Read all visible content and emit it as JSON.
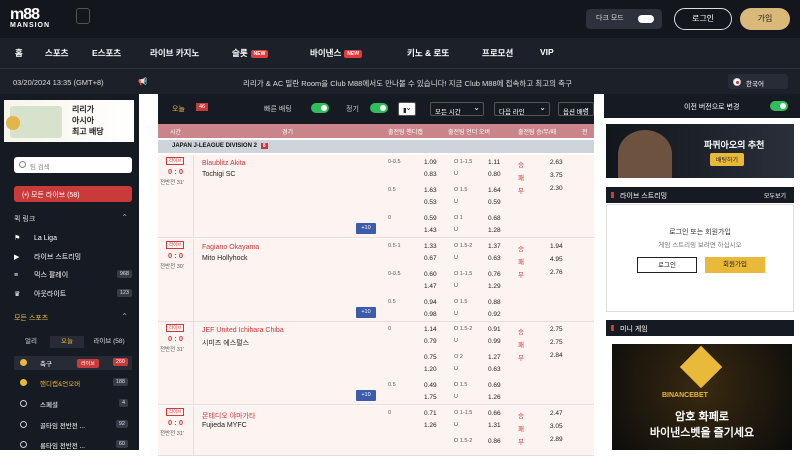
{
  "header": {
    "logo_main": "m88",
    "logo_sub": "MANSION",
    "dark_mode_label": "다크 모드",
    "login_label": "로그인",
    "join_label": "가입"
  },
  "nav": {
    "items": [
      "홈",
      "스포츠",
      "E스포츠",
      "라이브 카지노",
      "슬롯",
      "바이낸스",
      "키노 & 로또",
      "프로모션",
      "VIP"
    ],
    "new_badge": "NEW"
  },
  "ticker": {
    "datetime": "03/20/2024 13:35 (GMT+8)",
    "message": "리리가 & AC 밀란 Room을 Club M88에서도 만나볼 수 있습니다! 지금 Club M88에 접속하고 최고의 축구",
    "language": "한국어"
  },
  "left": {
    "promo_text": [
      "리리가",
      "아시아",
      "최고 배당"
    ],
    "search_placeholder": "팀 검색",
    "all_live": "(•) 모든 라이브 (58)",
    "quick_links_title": "퀵 링크",
    "quick_links": [
      {
        "label": "La Liga",
        "icon": "trophy-icon",
        "count": ""
      },
      {
        "label": "라이브 스트리밍",
        "icon": "play-icon",
        "count": ""
      },
      {
        "label": "믹스 팔레이",
        "icon": "list-icon",
        "count": "968"
      },
      {
        "label": "아웃라이트",
        "icon": "cup-icon",
        "count": "123"
      }
    ],
    "all_sports_title": "모든 스포츠",
    "filter_tabs": [
      "얼리",
      "오늘",
      "라이브 (58)"
    ],
    "sports": [
      {
        "label": "축구",
        "live": "라이브",
        "count": "260"
      },
      {
        "label": "핸디캡&언오버",
        "live": "",
        "count": "188"
      },
      {
        "label": "스페셜",
        "live": "",
        "count": "4"
      },
      {
        "label": "골타임 전반전 ...",
        "live": "",
        "count": "92"
      },
      {
        "label": "롱타임 전반전 ...",
        "live": "",
        "count": "60"
      }
    ]
  },
  "center": {
    "today_label": "오늘",
    "today_count": "46",
    "quick_bet_label": "빠른 배팅",
    "regular_label": "정기",
    "sort_time": "모든 시간",
    "odds_type": "다음 라인",
    "more_label": "옵션 배팅",
    "columns": [
      "시간",
      "경기",
      "출전팀 핸디캡",
      "출전팀 언더 오버",
      "출전팀 승/무/패",
      "전"
    ],
    "league": "JAPAN J-LEAGUE DIVISION 2",
    "league_count": "8",
    "live_tag": "라이브",
    "plus10": "+10",
    "matches": [
      {
        "score": "0 : 0",
        "time": "전반전 31'",
        "home": "Blaublitz Akita",
        "away": "Tochigi SC",
        "rows": [
          {
            "h": "0-0.5",
            "h1": "1.09",
            "h2": "0.83",
            "ou": "O 1-1.5",
            "u": "U",
            "o1": "1.11",
            "o2": "0.80",
            "x": [
              "2.63",
              "3.75",
              "2.30"
            ]
          },
          {
            "h": "0.5",
            "h1": "1.63",
            "h2": "0.53",
            "ou": "O 1.5",
            "u": "U",
            "o1": "1.64",
            "o2": "0.59",
            "x": []
          },
          {
            "h": "0",
            "h1": "0.59",
            "h2": "1.43",
            "ou": "O 1",
            "u": "U",
            "o1": "0.68",
            "o2": "1.28",
            "x": []
          }
        ]
      },
      {
        "score": "0 : 0",
        "time": "전반전 30'",
        "home": "Fagiano Okayama",
        "away": "Mito Hollyhock",
        "rows": [
          {
            "h": "0.5-1",
            "h1": "1.33",
            "h2": "0.67",
            "ou": "O 1.5-2",
            "u": "U",
            "o1": "1.37",
            "o2": "0.63",
            "x": [
              "1.94",
              "4.95",
              "2.76"
            ]
          },
          {
            "h": "0-0.5",
            "h1": "0.60",
            "h2": "1.47",
            "ou": "O 1-1.5",
            "u": "U",
            "o1": "0.76",
            "o2": "1.29",
            "x": []
          },
          {
            "h": "0.5",
            "h1": "0.94",
            "h2": "0.98",
            "ou": "O 1.5",
            "u": "U",
            "o1": "0.88",
            "o2": "0.92",
            "x": []
          }
        ]
      },
      {
        "score": "0 : 0",
        "time": "전반전 31'",
        "home": "JEF United Ichihara Chiba",
        "away": "시미즈 에스펄스",
        "rows": [
          {
            "h": "0",
            "h1": "1.14",
            "h2": "0.79",
            "ou": "O 1.5-2",
            "u": "U",
            "o1": "0.91",
            "o2": "0.99",
            "x": [
              "2.75",
              "2.75",
              "2.84"
            ]
          },
          {
            "h": "",
            "h1": "0.75",
            "h2": "1.20",
            "ou": "O 2",
            "u": "U",
            "o1": "1.27",
            "o2": "0.63",
            "x": []
          },
          {
            "h": "0.5",
            "h1": "0.49",
            "h2": "1.75",
            "ou": "O 1.5",
            "u": "U",
            "o1": "0.69",
            "o2": "1.26",
            "x": []
          }
        ]
      },
      {
        "score": "0 : 0",
        "time": "전반전 31'",
        "home": "몬테디오 야마가타",
        "away": "Fujieda MYFC",
        "rows": [
          {
            "h": "0",
            "h1": "0.71",
            "h2": "1.26",
            "ou": "O 1-1.5",
            "u": "U",
            "o1": "0.66",
            "o2": "1.31",
            "x": [
              "2.47",
              "3.05",
              "2.89"
            ]
          },
          {
            "h": "",
            "h1": "",
            "h2": "",
            "ou": "O 1.5-2",
            "u": "",
            "o1": "0.86",
            "o2": "",
            "x": []
          }
        ]
      }
    ],
    "result_labels": [
      "승",
      "패",
      "무"
    ]
  },
  "right": {
    "old_version": "이전 버전으로 변경",
    "banner_title": "파퀴아오의 추천",
    "banner_btn": "배팅하기",
    "stream_title": "라이브 스트리밍",
    "stream_go": "모두보기",
    "stream_msg1": "로그인 또는 회원가입",
    "stream_msg2": "게임 스트리밍 보려면 하십시오",
    "stream_login": "로그인",
    "stream_join": "회원가입",
    "mini_game_title": "미니 게임",
    "bb_brand": "BINANCEBET",
    "bb_line1": "암호 화페로",
    "bb_line2": "바이낸스벳을 즐기세요"
  }
}
